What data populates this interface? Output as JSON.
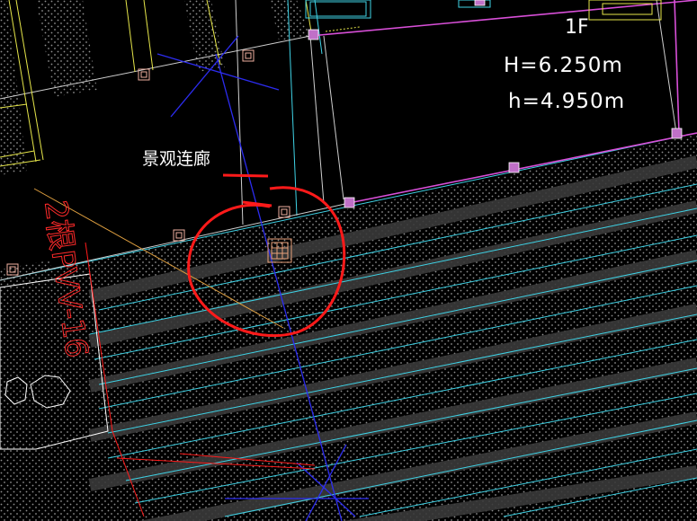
{
  "floor_label": "1F",
  "elevation_H": "H=6.250m",
  "elevation_h": "h=4.950m",
  "corridor_label": "景观连廊",
  "rebar_note": "2根PVV-16",
  "colors": {
    "background": "#000000",
    "hatch_dots": "#9a9a9a",
    "cyan_lines": "#3fd3e6",
    "magenta_edge": "#d84fd8",
    "yellow_lines": "#e6e64a",
    "blue_lines": "#2c2cf0",
    "red_markup": "#ff1a1a",
    "orange_fixture": "#e8a07a"
  },
  "icons": {
    "column_marker": "square-column-icon",
    "drain_grate": "grate-icon",
    "markup_circle": "circle-highlight-icon"
  }
}
